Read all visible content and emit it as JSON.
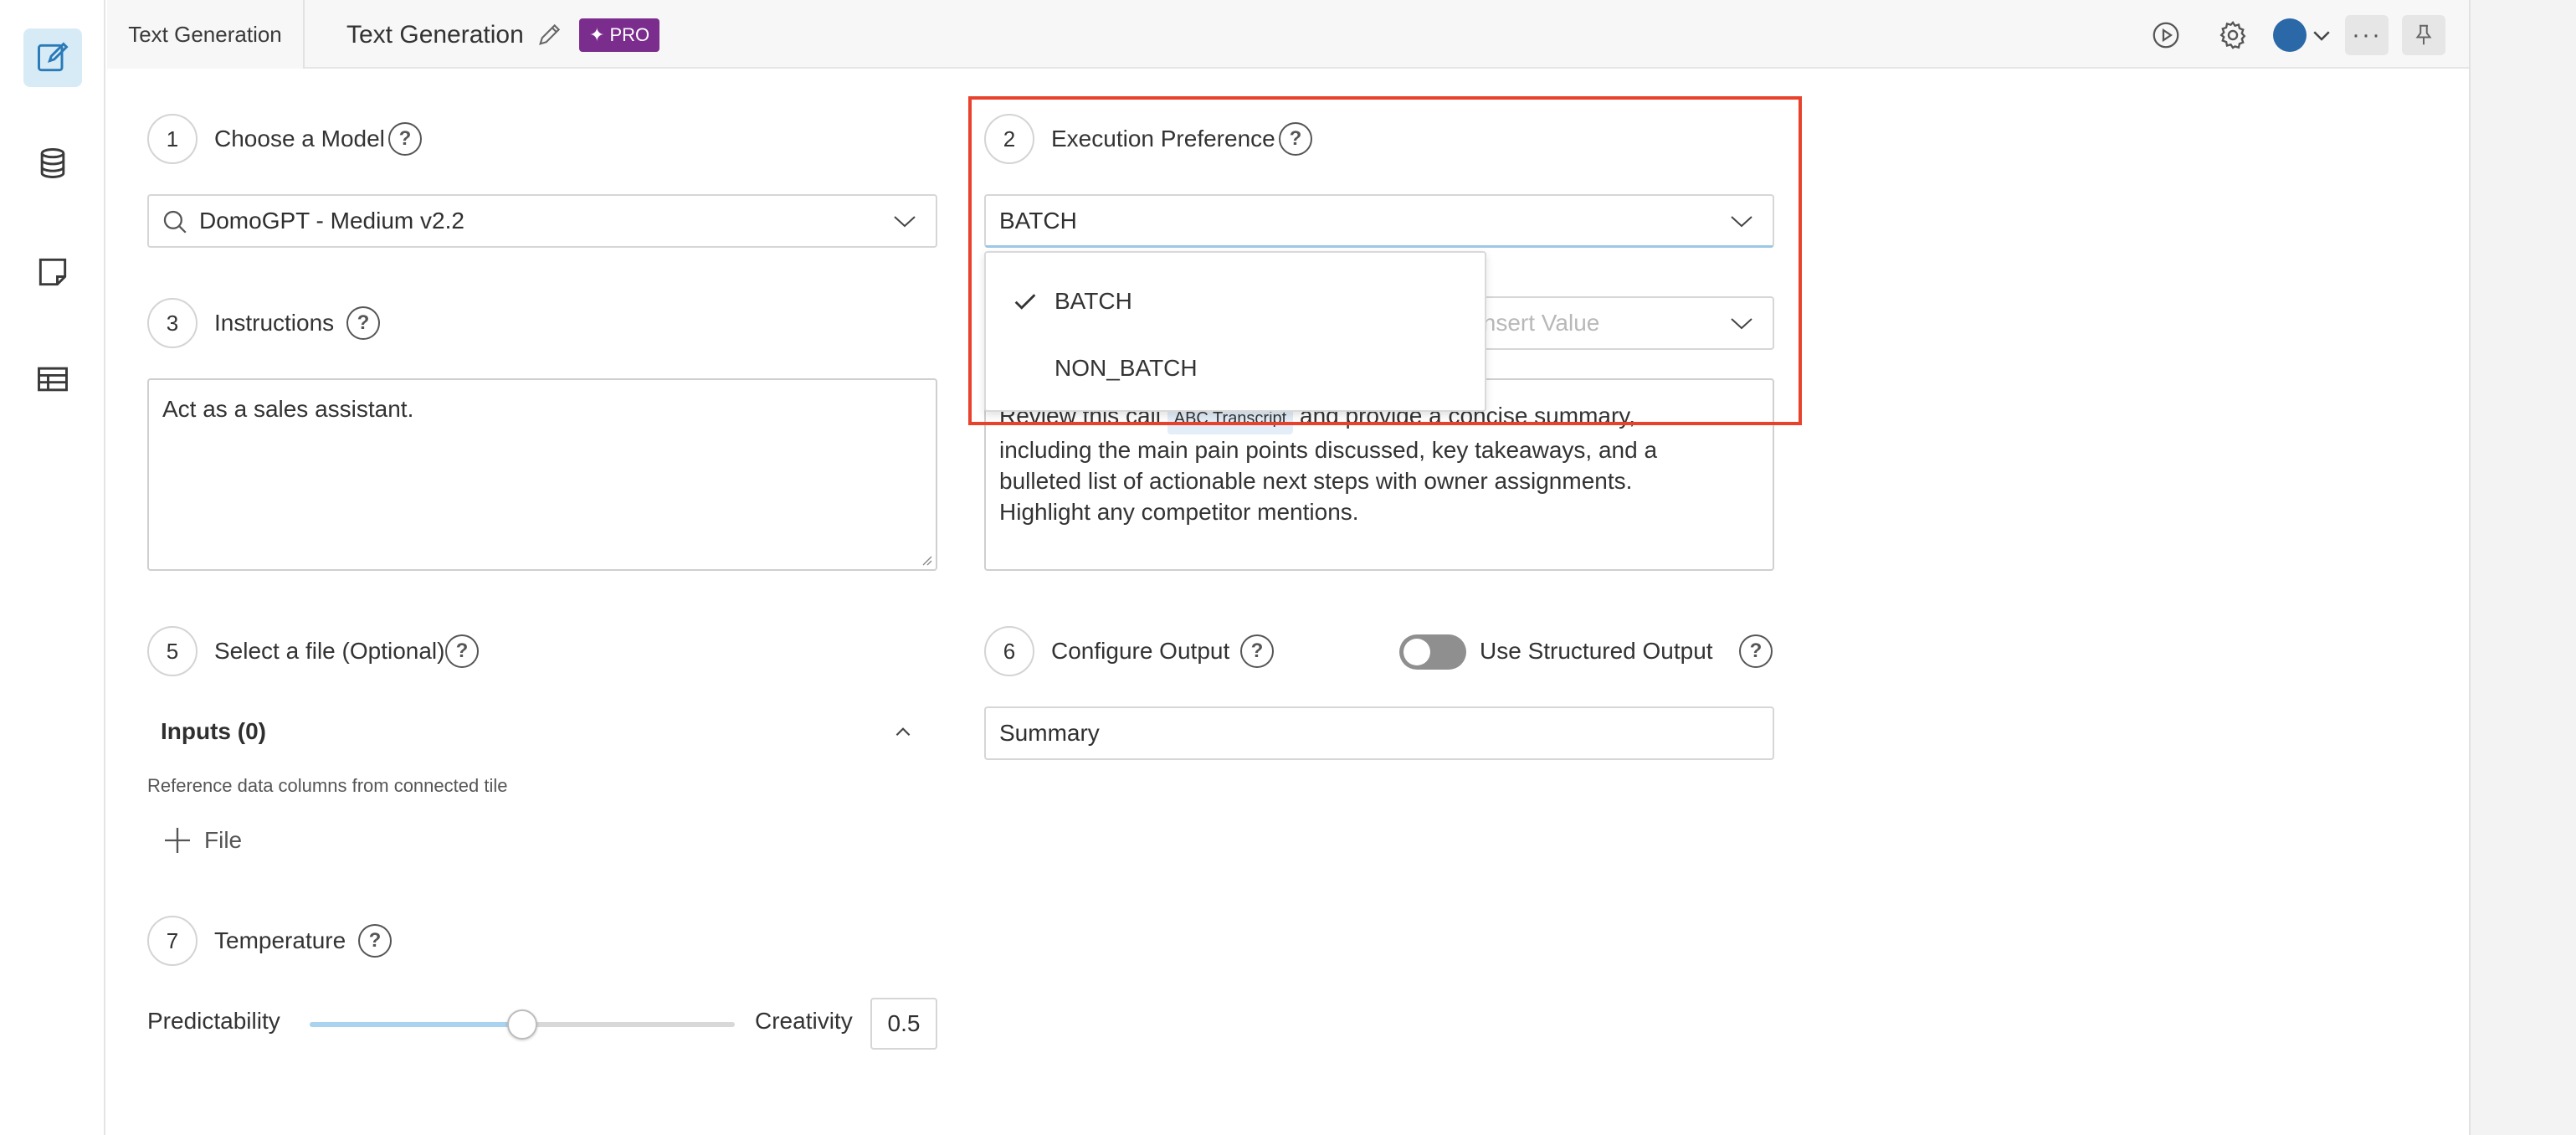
{
  "colors": {
    "accent": "#d7ebf7",
    "pro_badge": "#7b2d8e",
    "highlight": "#e8412c",
    "avatar": "#2a68a8"
  },
  "rail": {
    "items": [
      {
        "icon": "edit-icon",
        "active": true
      },
      {
        "icon": "database-icon",
        "active": false
      },
      {
        "icon": "note-icon",
        "active": false
      },
      {
        "icon": "table-icon",
        "active": false
      }
    ]
  },
  "header": {
    "tab_label": "Text Generation",
    "title": "Text Generation",
    "pro_label": "PRO",
    "icons": [
      "play-icon",
      "gear-icon",
      "avatar",
      "chevron-down-icon",
      "more-icon",
      "pin-icon"
    ]
  },
  "steps": {
    "s1": {
      "num": "1",
      "label": "Choose a Model"
    },
    "s2": {
      "num": "2",
      "label": "Execution Preference"
    },
    "s3": {
      "num": "3",
      "label": "Instructions"
    },
    "s5": {
      "num": "5",
      "label": "Select a file (Optional)"
    },
    "s6": {
      "num": "6",
      "label": "Configure Output"
    },
    "s7": {
      "num": "7",
      "label": "Temperature"
    }
  },
  "help_symbol": "?",
  "model_select": {
    "value": "DomoGPT - Medium v2.2"
  },
  "execution_select": {
    "value": "BATCH",
    "options": [
      {
        "label": "BATCH",
        "selected": true
      },
      {
        "label": "NON_BATCH",
        "selected": false
      }
    ]
  },
  "insert_value": {
    "placeholder": "Insert Value"
  },
  "instructions": {
    "value": "Act as a sales assistant."
  },
  "prompt": {
    "before_chip": "Review this call ",
    "chip_label": "ABC Transcript",
    "after_chip": " and provide a concise summary,",
    "line2": "including the main pain points discussed, key takeaways, and a",
    "line3": "bulleted list of actionable next steps with owner assignments.",
    "line4": "Highlight any competitor mentions."
  },
  "inputs": {
    "title": "Inputs (0)",
    "description": "Reference data columns from connected tile",
    "add_file_label": "File"
  },
  "structured_output": {
    "label": "Use Structured Output",
    "enabled": false
  },
  "output": {
    "value": "Summary"
  },
  "temperature": {
    "left_label": "Predictability",
    "right_label": "Creativity",
    "value": "0.5",
    "fraction": 0.5
  }
}
